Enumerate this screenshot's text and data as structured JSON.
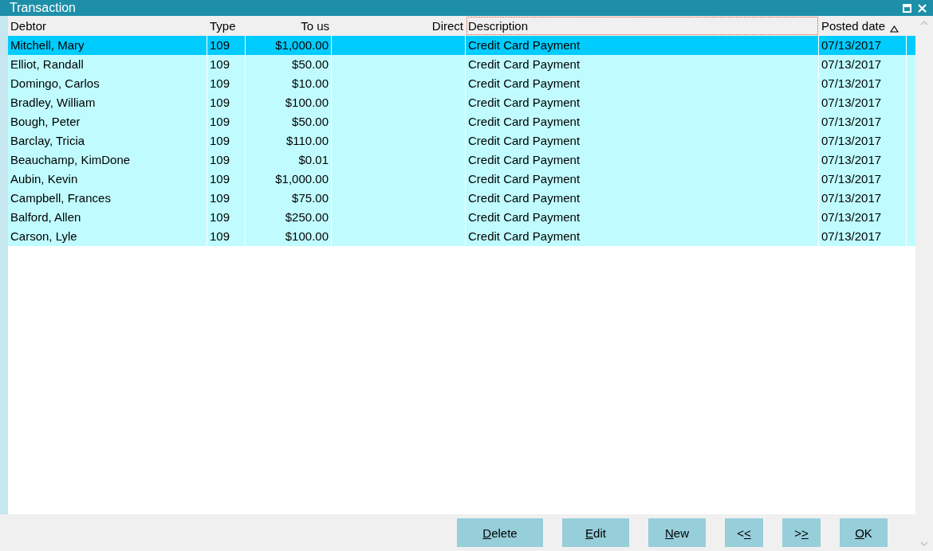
{
  "window": {
    "title": "Transaction"
  },
  "table": {
    "columns": [
      {
        "label": "Debtor",
        "focused": false,
        "sorted": false
      },
      {
        "label": "Type",
        "focused": false,
        "sorted": false
      },
      {
        "label": "To us",
        "focused": false,
        "sorted": false
      },
      {
        "label": "Direct",
        "focused": false,
        "sorted": false
      },
      {
        "label": "Description",
        "focused": true,
        "sorted": false
      },
      {
        "label": "Posted date",
        "focused": false,
        "sorted": true
      }
    ],
    "rows": [
      {
        "selected": true,
        "cells": [
          "Mitchell, Mary",
          "109",
          "$1,000.00",
          "",
          "Credit Card Payment",
          "07/13/2017"
        ]
      },
      {
        "selected": false,
        "cells": [
          "Elliot, Randall",
          "109",
          "$50.00",
          "",
          "Credit Card Payment",
          "07/13/2017"
        ]
      },
      {
        "selected": false,
        "cells": [
          "Domingo, Carlos",
          "109",
          "$10.00",
          "",
          "Credit Card Payment",
          "07/13/2017"
        ]
      },
      {
        "selected": false,
        "cells": [
          "Bradley, William",
          "109",
          "$100.00",
          "",
          "Credit Card Payment",
          "07/13/2017"
        ]
      },
      {
        "selected": false,
        "cells": [
          "Bough, Peter",
          "109",
          "$50.00",
          "",
          "Credit Card Payment",
          "07/13/2017"
        ]
      },
      {
        "selected": false,
        "cells": [
          "Barclay, Tricia",
          "109",
          "$110.00",
          "",
          "Credit Card Payment",
          "07/13/2017"
        ]
      },
      {
        "selected": false,
        "cells": [
          "Beauchamp, KimDone",
          "109",
          "$0.01",
          "",
          "Credit Card Payment",
          "07/13/2017"
        ]
      },
      {
        "selected": false,
        "cells": [
          "Aubin, Kevin",
          "109",
          "$1,000.00",
          "",
          "Credit Card Payment",
          "07/13/2017"
        ]
      },
      {
        "selected": false,
        "cells": [
          "Campbell, Frances",
          "109",
          "$75.00",
          "",
          "Credit Card Payment",
          "07/13/2017"
        ]
      },
      {
        "selected": false,
        "cells": [
          "Balford, Allen",
          "109",
          "$250.00",
          "",
          "Credit Card Payment",
          "07/13/2017"
        ]
      },
      {
        "selected": false,
        "cells": [
          "Carson, Lyle",
          "109",
          "$100.00",
          "",
          "Credit Card Payment",
          "07/13/2017"
        ]
      }
    ]
  },
  "buttons": [
    {
      "key": "D",
      "after": "elete"
    },
    {
      "key": "E",
      "after": "dit"
    },
    {
      "key": "N",
      "after": "ew"
    },
    {
      "before": "<",
      "key": "<"
    },
    {
      "before": ">",
      "key": ">"
    },
    {
      "key": "O",
      "after": "K"
    }
  ]
}
